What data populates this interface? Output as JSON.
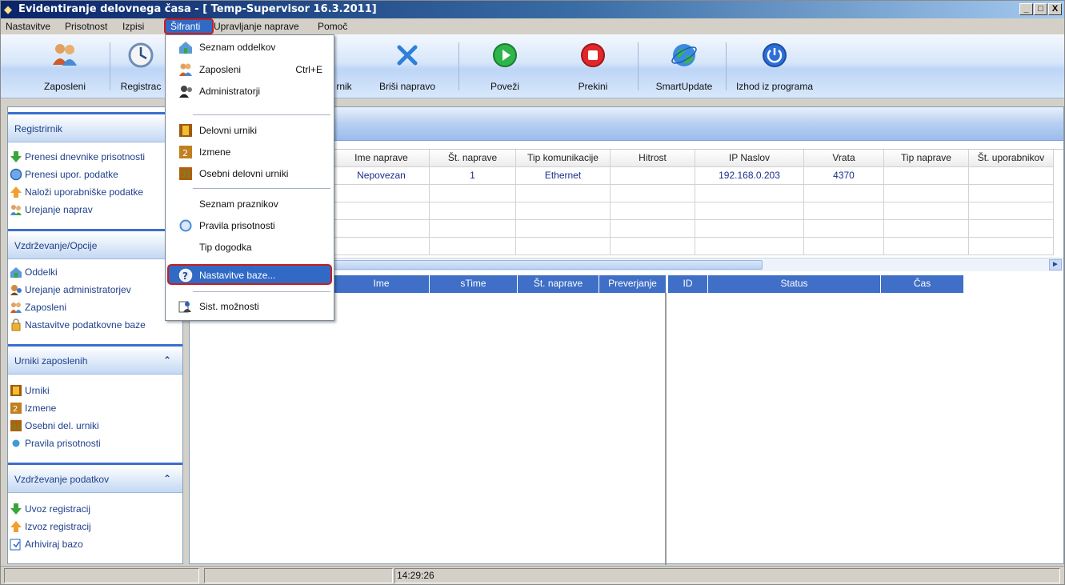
{
  "window": {
    "title": "Evidentiranje delovnega časa - [ Temp-Supervisor 16.3.2011]",
    "minimize": "_",
    "maximize": "□",
    "close": "X"
  },
  "menubar": {
    "items": [
      "Nastavitve",
      "Prisotnost",
      "Izpisi",
      "Šifranti",
      "Upravljanje naprave",
      "Pomoč"
    ]
  },
  "toolbar": {
    "buttons": [
      {
        "label": "Zaposleni",
        "icon": "users-icon"
      },
      {
        "label": "Registrac",
        "icon": "clock-icon"
      },
      {
        "label": "rnik",
        "icon": "calendar-icon"
      },
      {
        "label": "Briši napravo",
        "icon": "delete-x-icon"
      },
      {
        "label": "Poveži",
        "icon": "play-icon"
      },
      {
        "label": "Prekini",
        "icon": "stop-icon"
      },
      {
        "label": "SmartUpdate",
        "icon": "globe-icon"
      },
      {
        "label": "Izhod iz programa",
        "icon": "power-icon"
      }
    ]
  },
  "sidebar": {
    "sections": [
      {
        "title": "Registrirnik",
        "chevron": "",
        "items": [
          {
            "label": "Prenesi dnevnike prisotnosti",
            "icon": "green-arrow-down-icon"
          },
          {
            "label": "Prenesi upor. podatke",
            "icon": "blue-circle-icon"
          },
          {
            "label": "Naloži uporabniške podatke",
            "icon": "orange-arrow-up-icon"
          },
          {
            "label": "Urejanje naprav",
            "icon": "users-icon"
          }
        ]
      },
      {
        "title": "Vzdrževanje/Opcije",
        "chevron": "",
        "items": [
          {
            "label": "Oddelki",
            "icon": "department-icon"
          },
          {
            "label": "Urejanje administratorjev",
            "icon": "admin-icon"
          },
          {
            "label": "Zaposleni",
            "icon": "users-icon"
          },
          {
            "label": "Nastavitve podatkovne baze",
            "icon": "database-icon"
          }
        ]
      },
      {
        "title": "Urniki zaposlenih",
        "chevron": "⌃",
        "items": [
          {
            "label": "Urniki",
            "icon": "schedule-icon"
          },
          {
            "label": "Izmene",
            "icon": "shift-icon"
          },
          {
            "label": "Osebni del. urniki",
            "icon": "personal-schedule-icon"
          },
          {
            "label": "Pravila prisotnosti",
            "icon": "blue-dot-icon"
          }
        ]
      },
      {
        "title": "Vzdrževanje podatkov",
        "chevron": "⌃",
        "items": [
          {
            "label": "Uvoz registracij",
            "icon": "green-arrow-down-icon"
          },
          {
            "label": "Izvoz registracij",
            "icon": "orange-arrow-up-icon"
          },
          {
            "label": "Arhiviraj bazo",
            "icon": "archive-icon"
          }
        ]
      }
    ]
  },
  "device_grid": {
    "columns": [
      "Ime naprave",
      "Št. naprave",
      "Tip komunikacije",
      "Hitrost",
      "IP Naslov",
      "Vrata",
      "Tip naprave",
      "Št. uporabnikov"
    ],
    "rows": [
      [
        "Nepovezan",
        "1",
        "Ethernet",
        "",
        "192.168.0.203",
        "4370",
        "",
        ""
      ]
    ],
    "empty_rows": 4
  },
  "log_grid_left": {
    "columns": [
      "Ime",
      "sTime",
      "Št. naprave",
      "Preverjanje"
    ]
  },
  "log_grid_right": {
    "columns": [
      "ID",
      "Status",
      "Čas"
    ]
  },
  "statusbar": {
    "time": "14:29:26"
  },
  "dropdown": {
    "items": [
      {
        "label": "Seznam oddelkov",
        "icon": "department-icon",
        "shortcut": ""
      },
      {
        "label": "Zaposleni",
        "icon": "users-icon",
        "shortcut": "Ctrl+E"
      },
      {
        "label": "Administratorji",
        "icon": "admin-icon",
        "shortcut": ""
      },
      {
        "label": "Delovni urniki",
        "icon": "schedule-icon",
        "shortcut": ""
      },
      {
        "label": "Izmene",
        "icon": "shift-icon",
        "shortcut": ""
      },
      {
        "label": "Osebni delovni urniki",
        "icon": "personal-schedule-icon",
        "shortcut": ""
      },
      {
        "label": "Seznam praznikov",
        "icon": "",
        "shortcut": ""
      },
      {
        "label": "Pravila prisotnosti",
        "icon": "rules-icon",
        "shortcut": ""
      },
      {
        "label": "Tip dogodka",
        "icon": "",
        "shortcut": ""
      },
      {
        "label": "Nastavitve baze...",
        "icon": "settings-question-icon",
        "shortcut": "",
        "selected": true
      },
      {
        "label": "Sist. možnosti",
        "icon": "system-options-icon",
        "shortcut": ""
      }
    ]
  },
  "colors": {
    "highlight": "#316ac5",
    "annotation_red": "#c81e1e",
    "title_blue": "#0a246a"
  }
}
